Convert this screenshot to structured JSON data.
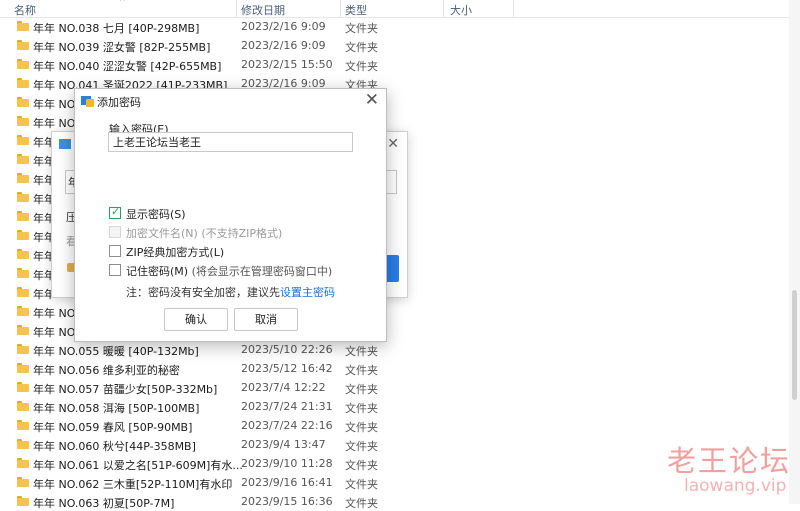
{
  "columns": {
    "name": "名称",
    "date": "修改日期",
    "type": "类型",
    "size": "大小"
  },
  "files": [
    {
      "name": "年年 NO.038 七月 [40P-298MB]",
      "date": "2023/2/16 9:09",
      "type": "文件夹"
    },
    {
      "name": "年年 NO.039 涩女警 [82P-255MB]",
      "date": "2023/2/16 9:09",
      "type": "文件夹"
    },
    {
      "name": "年年 NO.040 涩涩女警 [42P-655MB]",
      "date": "2023/2/15 15:50",
      "type": "文件夹"
    },
    {
      "name": "年年 NO.041 圣诞2022 [41P-233MB]",
      "date": "2023/2/16 9:09",
      "type": "文件夹"
    },
    {
      "name": "年年 NO",
      "date": "",
      "type": ""
    },
    {
      "name": "年年 NO",
      "date": "",
      "type": ""
    },
    {
      "name": "年年 N",
      "date": "",
      "type": ""
    },
    {
      "name": "年年",
      "date": "",
      "type": ""
    },
    {
      "name": "年年",
      "date": "",
      "type": ""
    },
    {
      "name": "年年",
      "date": "",
      "type": ""
    },
    {
      "name": "年年",
      "date": "",
      "type": ""
    },
    {
      "name": "年年",
      "date": "",
      "type": ""
    },
    {
      "name": "年年",
      "date": "",
      "type": ""
    },
    {
      "name": "年年",
      "date": "",
      "type": ""
    },
    {
      "name": "年年",
      "date": "",
      "type": ""
    },
    {
      "name": "年年 NO",
      "date": "",
      "type": ""
    },
    {
      "name": "年年 NO",
      "date": "",
      "type": ""
    },
    {
      "name": "年年 NO.055 暖暖 [40P-132Mb]",
      "date": "2023/5/10 22:26",
      "type": "文件夹"
    },
    {
      "name": "年年 NO.056 维多利亚的秘密",
      "date": "2023/5/12 16:42",
      "type": "文件夹"
    },
    {
      "name": "年年 NO.057 苗疆少女[50P-332Mb]",
      "date": "2023/7/4 12:22",
      "type": "文件夹"
    },
    {
      "name": "年年 NO.058 洱海 [50P-100MB]",
      "date": "2023/7/24 21:31",
      "type": "文件夹"
    },
    {
      "name": "年年 NO.059 春风 [50P-90MB]",
      "date": "2023/7/24 22:16",
      "type": "文件夹"
    },
    {
      "name": "年年 NO.060 秋兮[44P-358MB]",
      "date": "2023/9/4 13:47",
      "type": "文件夹"
    },
    {
      "name": "年年 NO.061 以爱之名[51P-609M]有水...",
      "date": "2023/9/10 11:28",
      "type": "文件夹"
    },
    {
      "name": "年年 NO.062 三木重[52P-110M]有水印",
      "date": "2023/9/16 16:41",
      "type": "文件夹"
    },
    {
      "name": "年年 NO.063 初夏[50P-7M]",
      "date": "2023/9/15 16:36",
      "type": "文件夹"
    }
  ],
  "bg_dialog": {
    "field_text": "年",
    "text1": "压",
    "text2": "看"
  },
  "dialog": {
    "title": "添加密码",
    "input_label": "输入密码(E)",
    "password_value": "上老王论坛当老王",
    "show_password": "显示密码(S)",
    "encrypt_filenames": "加密文件名(N)",
    "encrypt_filenames_note": "(不支持ZIP格式)",
    "zip_classic": "ZIP经典加密方式(L)",
    "remember_password": "记住密码(M)",
    "remember_note": "(将会显示在管理密码窗口中)",
    "hint_prefix": "注：密码没有安全加密，建议先",
    "hint_link": "设置主密码",
    "ok": "确认",
    "cancel": "取消"
  },
  "watermark": {
    "line1": "老王论坛",
    "line2": "laowang.vip"
  }
}
